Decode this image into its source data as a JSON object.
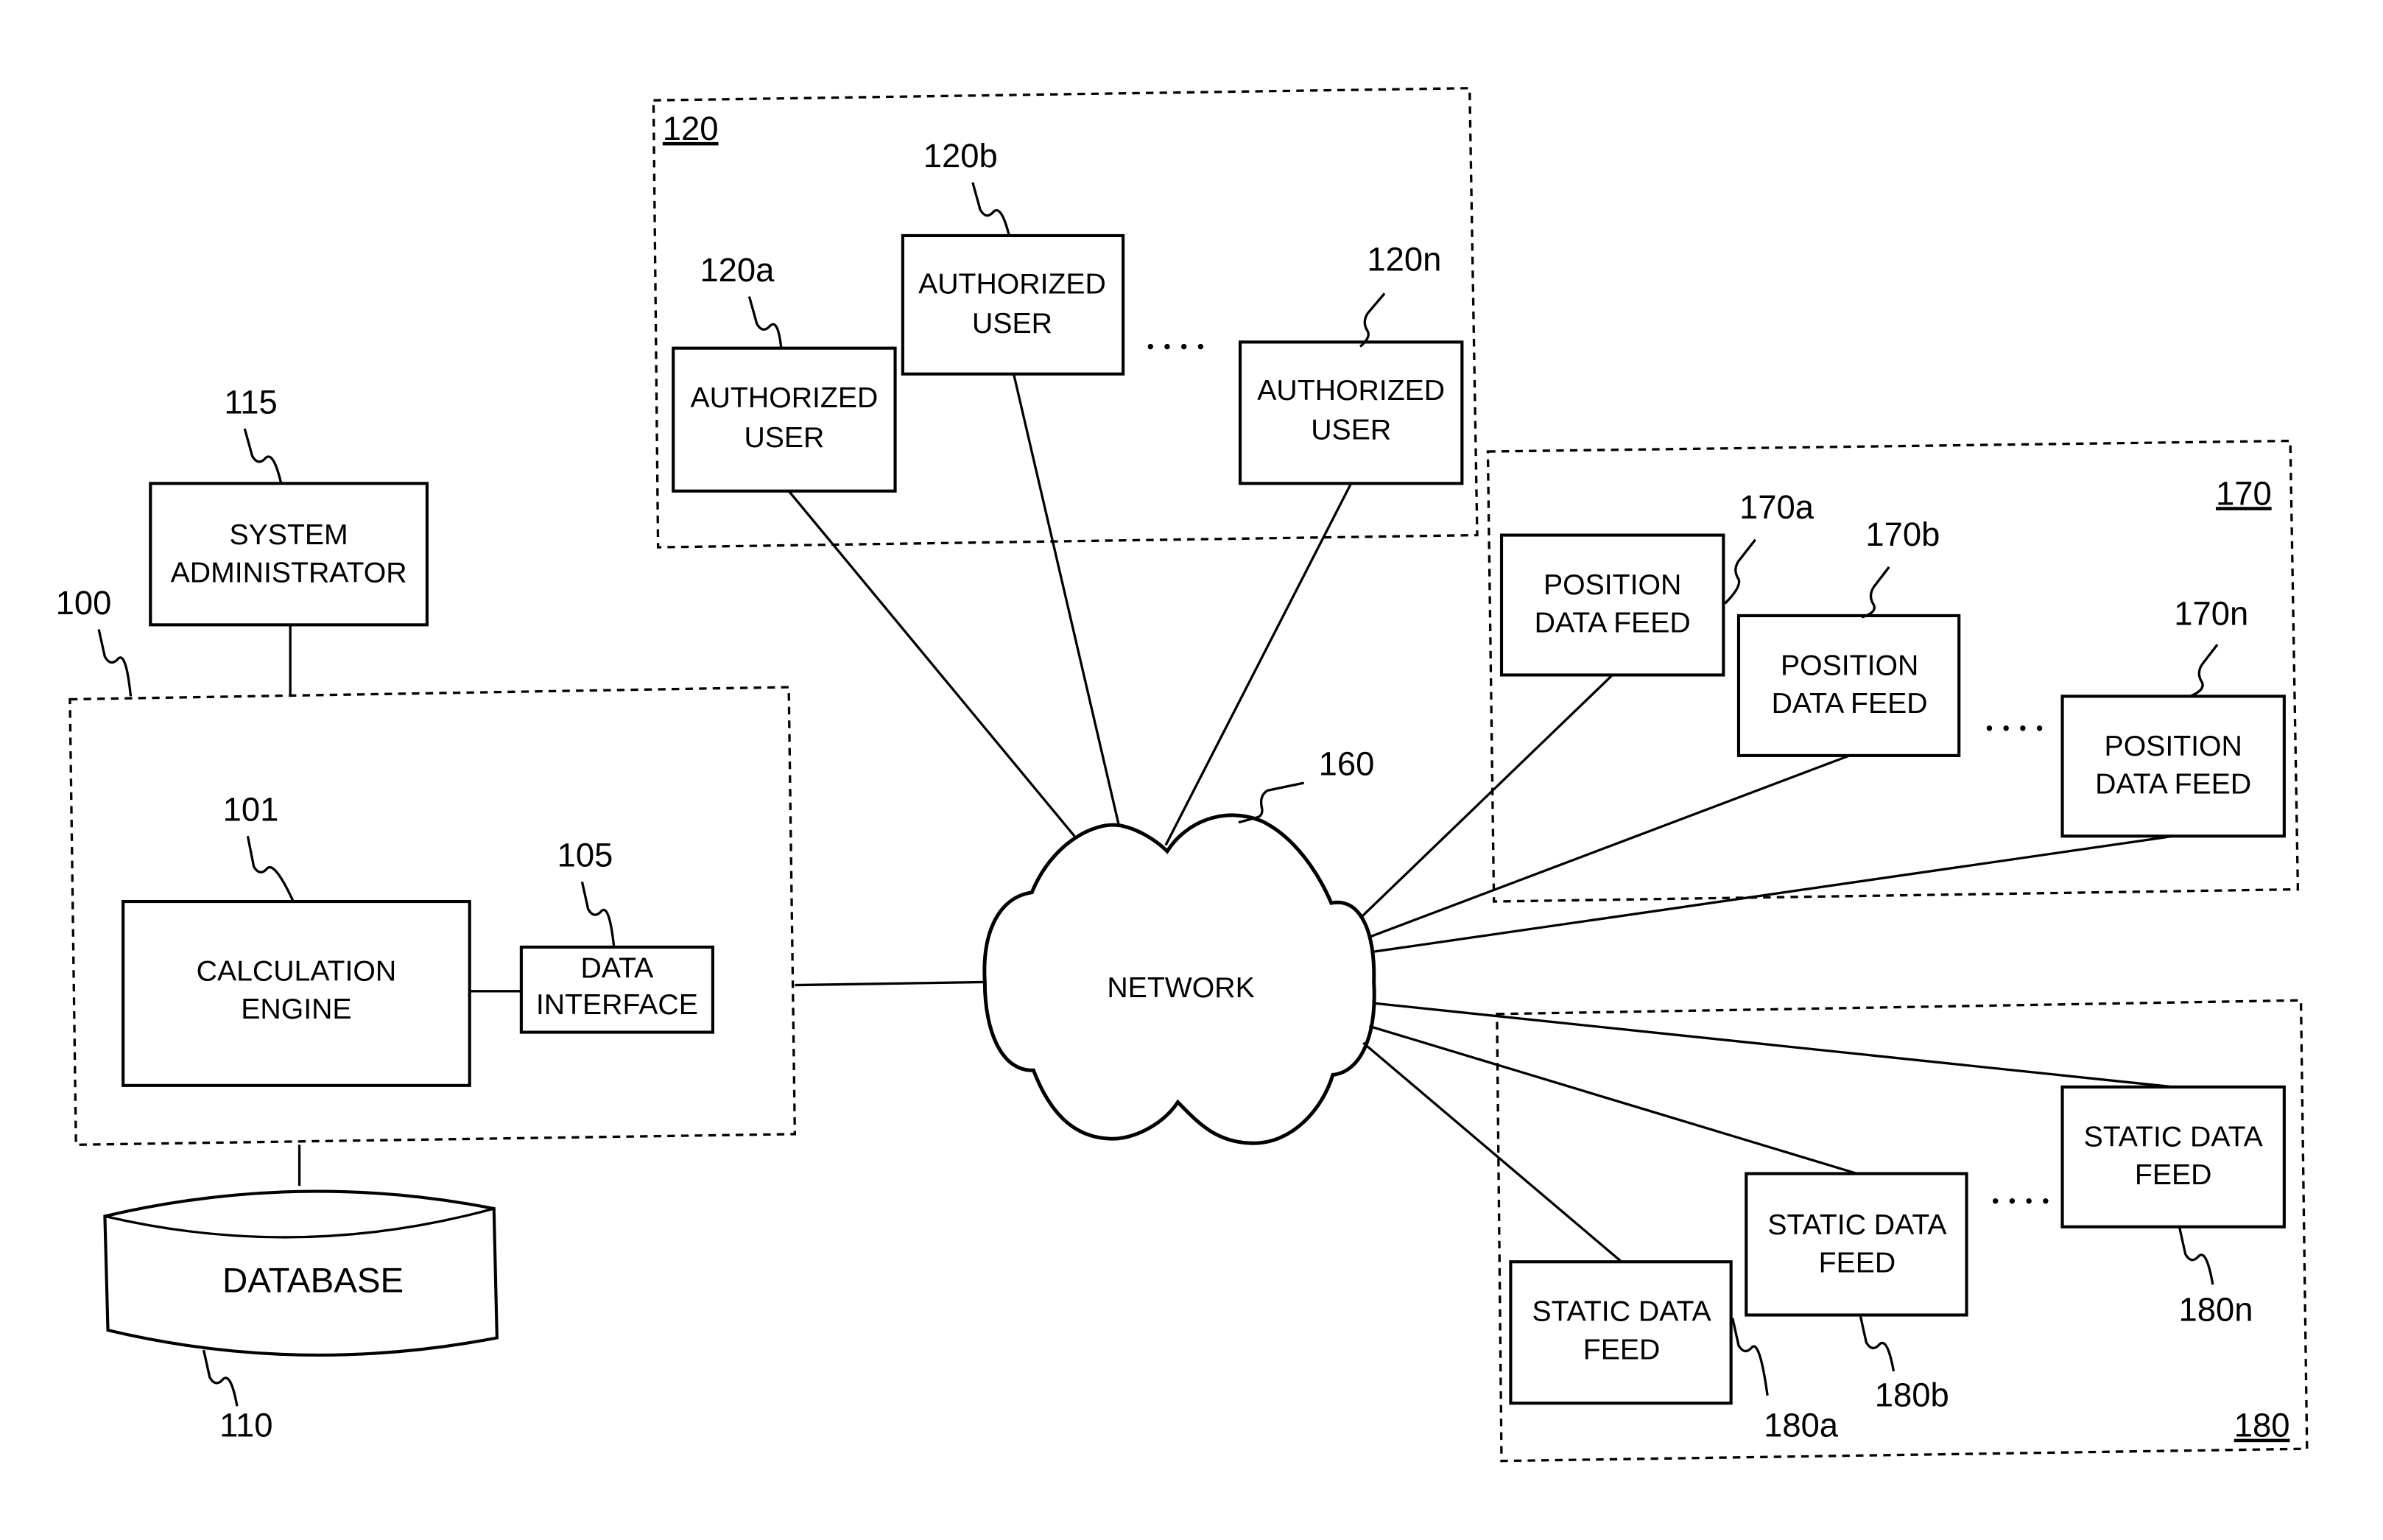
{
  "diagram": {
    "system": {
      "ref": "100",
      "calculation_engine": {
        "ref": "101",
        "lines": [
          "CALCULATION",
          "ENGINE"
        ]
      },
      "data_interface": {
        "ref": "105",
        "lines": [
          "DATA",
          "INTERFACE"
        ]
      }
    },
    "system_administrator": {
      "ref": "115",
      "lines": [
        "SYSTEM",
        "ADMINISTRATOR"
      ]
    },
    "database": {
      "ref": "110",
      "label": "DATABASE"
    },
    "network": {
      "ref": "160",
      "label": "NETWORK"
    },
    "authorized_users": {
      "group_ref": "120",
      "items": [
        {
          "ref": "120a",
          "lines": [
            "AUTHORIZED",
            "USER"
          ]
        },
        {
          "ref": "120b",
          "lines": [
            "AUTHORIZED",
            "USER"
          ]
        },
        {
          "ref": "120n",
          "lines": [
            "AUTHORIZED",
            "USER"
          ]
        }
      ]
    },
    "position_data_feeds": {
      "group_ref": "170",
      "items": [
        {
          "ref": "170a",
          "lines": [
            "POSITION",
            "DATA FEED"
          ]
        },
        {
          "ref": "170b",
          "lines": [
            "POSITION",
            "DATA FEED"
          ]
        },
        {
          "ref": "170n",
          "lines": [
            "POSITION",
            "DATA FEED"
          ]
        }
      ]
    },
    "static_data_feeds": {
      "group_ref": "180",
      "items": [
        {
          "ref": "180a",
          "lines": [
            "STATIC DATA",
            "FEED"
          ]
        },
        {
          "ref": "180b",
          "lines": [
            "STATIC DATA",
            "FEED"
          ]
        },
        {
          "ref": "180n",
          "lines": [
            "STATIC DATA",
            "FEED"
          ]
        }
      ]
    },
    "ellipsis": "...."
  }
}
